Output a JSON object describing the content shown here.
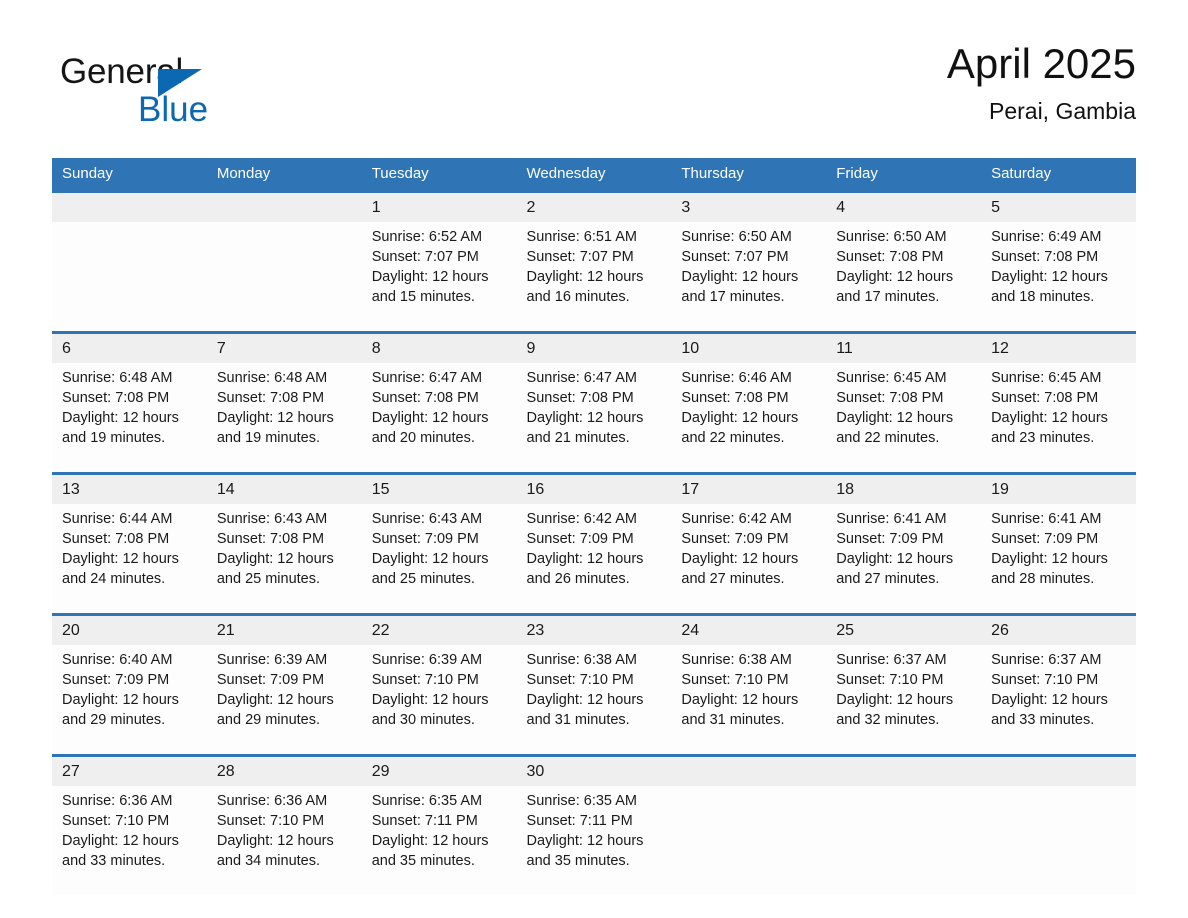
{
  "brand": {
    "name_part1": "General",
    "name_part2": "Blue",
    "accent_color": "#0b68b1"
  },
  "header": {
    "month_title": "April 2025",
    "location": "Perai, Gambia"
  },
  "calendar": {
    "header_color": "#2f74b5",
    "daynum_band_color": "#efefef",
    "weekday_headers": [
      "Sunday",
      "Monday",
      "Tuesday",
      "Wednesday",
      "Thursday",
      "Friday",
      "Saturday"
    ],
    "weeks": [
      {
        "days": [
          {
            "num": "",
            "sunrise": "",
            "sunset": "",
            "daylight_l1": "",
            "daylight_l2": ""
          },
          {
            "num": "",
            "sunrise": "",
            "sunset": "",
            "daylight_l1": "",
            "daylight_l2": ""
          },
          {
            "num": "1",
            "sunrise": "Sunrise: 6:52 AM",
            "sunset": "Sunset: 7:07 PM",
            "daylight_l1": "Daylight: 12 hours",
            "daylight_l2": "and 15 minutes."
          },
          {
            "num": "2",
            "sunrise": "Sunrise: 6:51 AM",
            "sunset": "Sunset: 7:07 PM",
            "daylight_l1": "Daylight: 12 hours",
            "daylight_l2": "and 16 minutes."
          },
          {
            "num": "3",
            "sunrise": "Sunrise: 6:50 AM",
            "sunset": "Sunset: 7:07 PM",
            "daylight_l1": "Daylight: 12 hours",
            "daylight_l2": "and 17 minutes."
          },
          {
            "num": "4",
            "sunrise": "Sunrise: 6:50 AM",
            "sunset": "Sunset: 7:08 PM",
            "daylight_l1": "Daylight: 12 hours",
            "daylight_l2": "and 17 minutes."
          },
          {
            "num": "5",
            "sunrise": "Sunrise: 6:49 AM",
            "sunset": "Sunset: 7:08 PM",
            "daylight_l1": "Daylight: 12 hours",
            "daylight_l2": "and 18 minutes."
          }
        ]
      },
      {
        "days": [
          {
            "num": "6",
            "sunrise": "Sunrise: 6:48 AM",
            "sunset": "Sunset: 7:08 PM",
            "daylight_l1": "Daylight: 12 hours",
            "daylight_l2": "and 19 minutes."
          },
          {
            "num": "7",
            "sunrise": "Sunrise: 6:48 AM",
            "sunset": "Sunset: 7:08 PM",
            "daylight_l1": "Daylight: 12 hours",
            "daylight_l2": "and 19 minutes."
          },
          {
            "num": "8",
            "sunrise": "Sunrise: 6:47 AM",
            "sunset": "Sunset: 7:08 PM",
            "daylight_l1": "Daylight: 12 hours",
            "daylight_l2": "and 20 minutes."
          },
          {
            "num": "9",
            "sunrise": "Sunrise: 6:47 AM",
            "sunset": "Sunset: 7:08 PM",
            "daylight_l1": "Daylight: 12 hours",
            "daylight_l2": "and 21 minutes."
          },
          {
            "num": "10",
            "sunrise": "Sunrise: 6:46 AM",
            "sunset": "Sunset: 7:08 PM",
            "daylight_l1": "Daylight: 12 hours",
            "daylight_l2": "and 22 minutes."
          },
          {
            "num": "11",
            "sunrise": "Sunrise: 6:45 AM",
            "sunset": "Sunset: 7:08 PM",
            "daylight_l1": "Daylight: 12 hours",
            "daylight_l2": "and 22 minutes."
          },
          {
            "num": "12",
            "sunrise": "Sunrise: 6:45 AM",
            "sunset": "Sunset: 7:08 PM",
            "daylight_l1": "Daylight: 12 hours",
            "daylight_l2": "and 23 minutes."
          }
        ]
      },
      {
        "days": [
          {
            "num": "13",
            "sunrise": "Sunrise: 6:44 AM",
            "sunset": "Sunset: 7:08 PM",
            "daylight_l1": "Daylight: 12 hours",
            "daylight_l2": "and 24 minutes."
          },
          {
            "num": "14",
            "sunrise": "Sunrise: 6:43 AM",
            "sunset": "Sunset: 7:08 PM",
            "daylight_l1": "Daylight: 12 hours",
            "daylight_l2": "and 25 minutes."
          },
          {
            "num": "15",
            "sunrise": "Sunrise: 6:43 AM",
            "sunset": "Sunset: 7:09 PM",
            "daylight_l1": "Daylight: 12 hours",
            "daylight_l2": "and 25 minutes."
          },
          {
            "num": "16",
            "sunrise": "Sunrise: 6:42 AM",
            "sunset": "Sunset: 7:09 PM",
            "daylight_l1": "Daylight: 12 hours",
            "daylight_l2": "and 26 minutes."
          },
          {
            "num": "17",
            "sunrise": "Sunrise: 6:42 AM",
            "sunset": "Sunset: 7:09 PM",
            "daylight_l1": "Daylight: 12 hours",
            "daylight_l2": "and 27 minutes."
          },
          {
            "num": "18",
            "sunrise": "Sunrise: 6:41 AM",
            "sunset": "Sunset: 7:09 PM",
            "daylight_l1": "Daylight: 12 hours",
            "daylight_l2": "and 27 minutes."
          },
          {
            "num": "19",
            "sunrise": "Sunrise: 6:41 AM",
            "sunset": "Sunset: 7:09 PM",
            "daylight_l1": "Daylight: 12 hours",
            "daylight_l2": "and 28 minutes."
          }
        ]
      },
      {
        "days": [
          {
            "num": "20",
            "sunrise": "Sunrise: 6:40 AM",
            "sunset": "Sunset: 7:09 PM",
            "daylight_l1": "Daylight: 12 hours",
            "daylight_l2": "and 29 minutes."
          },
          {
            "num": "21",
            "sunrise": "Sunrise: 6:39 AM",
            "sunset": "Sunset: 7:09 PM",
            "daylight_l1": "Daylight: 12 hours",
            "daylight_l2": "and 29 minutes."
          },
          {
            "num": "22",
            "sunrise": "Sunrise: 6:39 AM",
            "sunset": "Sunset: 7:10 PM",
            "daylight_l1": "Daylight: 12 hours",
            "daylight_l2": "and 30 minutes."
          },
          {
            "num": "23",
            "sunrise": "Sunrise: 6:38 AM",
            "sunset": "Sunset: 7:10 PM",
            "daylight_l1": "Daylight: 12 hours",
            "daylight_l2": "and 31 minutes."
          },
          {
            "num": "24",
            "sunrise": "Sunrise: 6:38 AM",
            "sunset": "Sunset: 7:10 PM",
            "daylight_l1": "Daylight: 12 hours",
            "daylight_l2": "and 31 minutes."
          },
          {
            "num": "25",
            "sunrise": "Sunrise: 6:37 AM",
            "sunset": "Sunset: 7:10 PM",
            "daylight_l1": "Daylight: 12 hours",
            "daylight_l2": "and 32 minutes."
          },
          {
            "num": "26",
            "sunrise": "Sunrise: 6:37 AM",
            "sunset": "Sunset: 7:10 PM",
            "daylight_l1": "Daylight: 12 hours",
            "daylight_l2": "and 33 minutes."
          }
        ]
      },
      {
        "days": [
          {
            "num": "27",
            "sunrise": "Sunrise: 6:36 AM",
            "sunset": "Sunset: 7:10 PM",
            "daylight_l1": "Daylight: 12 hours",
            "daylight_l2": "and 33 minutes."
          },
          {
            "num": "28",
            "sunrise": "Sunrise: 6:36 AM",
            "sunset": "Sunset: 7:10 PM",
            "daylight_l1": "Daylight: 12 hours",
            "daylight_l2": "and 34 minutes."
          },
          {
            "num": "29",
            "sunrise": "Sunrise: 6:35 AM",
            "sunset": "Sunset: 7:11 PM",
            "daylight_l1": "Daylight: 12 hours",
            "daylight_l2": "and 35 minutes."
          },
          {
            "num": "30",
            "sunrise": "Sunrise: 6:35 AM",
            "sunset": "Sunset: 7:11 PM",
            "daylight_l1": "Daylight: 12 hours",
            "daylight_l2": "and 35 minutes."
          },
          {
            "num": "",
            "sunrise": "",
            "sunset": "",
            "daylight_l1": "",
            "daylight_l2": ""
          },
          {
            "num": "",
            "sunrise": "",
            "sunset": "",
            "daylight_l1": "",
            "daylight_l2": ""
          },
          {
            "num": "",
            "sunrise": "",
            "sunset": "",
            "daylight_l1": "",
            "daylight_l2": ""
          }
        ]
      }
    ]
  }
}
